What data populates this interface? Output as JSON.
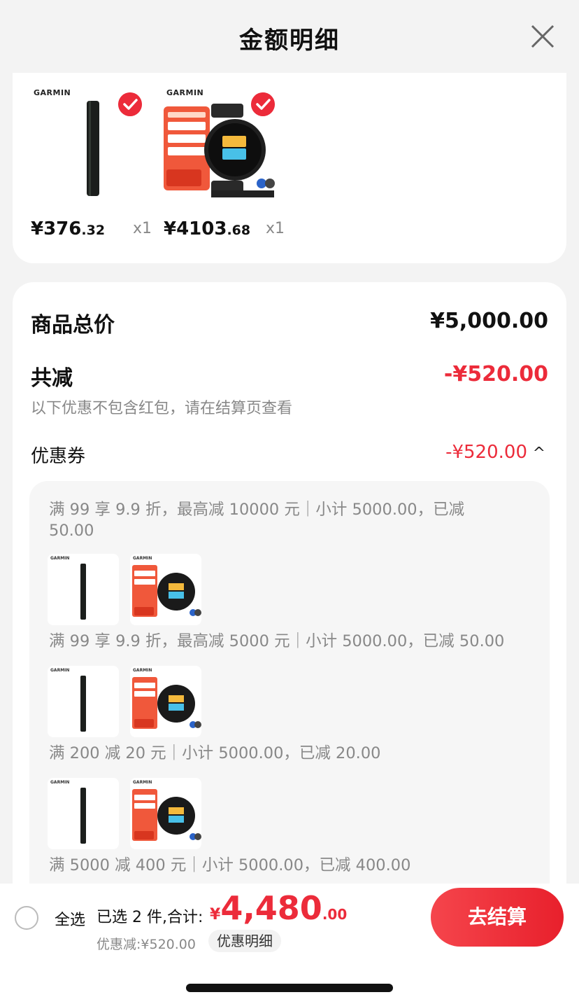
{
  "sheet": {
    "title": "金额明细"
  },
  "products": [
    {
      "brand": "GARMIN",
      "price_int": "¥376",
      "price_dec": ".32",
      "qty": "x1",
      "image": "watch-band",
      "selected": true
    },
    {
      "brand": "GARMIN",
      "price_int": "¥4103",
      "price_dec": ".68",
      "qty": "x1",
      "image": "fr965-watch-promo",
      "selected": true
    }
  ],
  "summary": {
    "total_label": "商品总价",
    "total_value": "¥5,000.00",
    "reduce_label": "共减",
    "reduce_value": "-¥520.00",
    "note": "以下优惠不包含红包，请在结算页查看",
    "coupon_label": "优惠券",
    "coupon_value": "-¥520.00",
    "caret": "^"
  },
  "coupons": [
    {
      "line1": "满 99 享 9.9 折，最高减 10000 元｜小计 5000.00，已减",
      "line2": "50.00"
    },
    {
      "line1": "满 99 享 9.9 折，最高减 5000 元｜小计 5000.00，已减 50.00"
    },
    {
      "line1": "满 200 减 20 元｜小计 5000.00，已减 20.00"
    },
    {
      "line1": "满 5000 减 400 元｜小计 5000.00，已减 400.00"
    }
  ],
  "thumb_brand": "GARMIN",
  "bottom": {
    "select_all": "全选",
    "selected_text": "已选 2 件,合计:",
    "total_cur": "¥",
    "total_int": "4,480",
    "total_dec": ".00",
    "discount": "优惠减:¥520.00",
    "detail_button": "优惠明细",
    "checkout_button": "去结算"
  },
  "colors": {
    "accent": "#ec2b3a",
    "muted": "#888888"
  }
}
